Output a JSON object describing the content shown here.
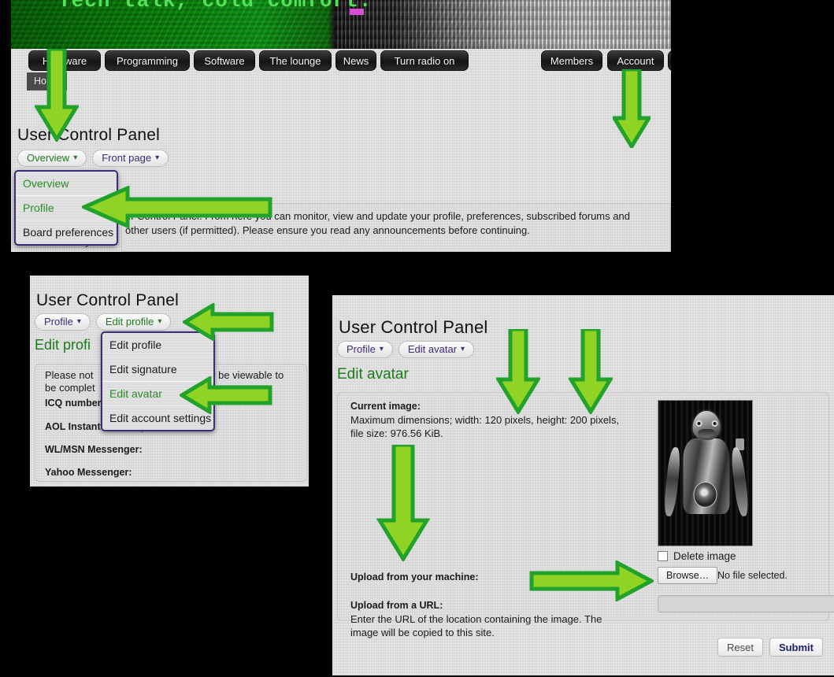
{
  "site": {
    "banner_text": "Tech talk, cold comfort.",
    "nav_items": [
      {
        "label": "Hardware"
      },
      {
        "label": "Programming"
      },
      {
        "label": "Software"
      },
      {
        "label": "The lounge"
      },
      {
        "label": "News"
      },
      {
        "label": "Turn radio on"
      }
    ],
    "nav_right_items": [
      {
        "label": "Members"
      },
      {
        "label": "Account"
      }
    ],
    "breadcrumb": "Home"
  },
  "panel_overview": {
    "title": "User Control Panel",
    "tabs": [
      {
        "label": "Overview",
        "caret": "⌄",
        "active": true
      },
      {
        "label": "Front page",
        "caret": "⌄",
        "active": false
      }
    ],
    "dropdown": [
      {
        "label": "Overview",
        "green": true
      },
      {
        "label": "Profile",
        "green": true
      },
      {
        "label": "Board preferences",
        "green": false
      }
    ],
    "subnav_behind": "Your activity",
    "body_line_1": "er Control Panel. From here you can monitor, view and update your profile, preferences, subscribed forums and",
    "body_line_2": "other users (if permitted). Please ensure you read any announcements before continuing."
  },
  "panel_profile": {
    "title": "User Control Panel",
    "tabs": [
      {
        "label": "Profile",
        "caret": "⌄",
        "active": false
      },
      {
        "label": "Edit profile",
        "caret": "⌄",
        "active": true
      }
    ],
    "section_heading": "Edit profi",
    "dropdown": [
      {
        "label": "Edit profile",
        "green": false
      },
      {
        "label": "Edit signature",
        "green": false
      },
      {
        "label": "Edit avatar",
        "green": true
      },
      {
        "label": "Edit account settings",
        "green": false
      }
    ],
    "note_line_1_left": "Please not",
    "note_line_1_right": "y be viewable to",
    "note_line_2_left": "be complet",
    "fields": [
      {
        "label": "ICQ number"
      },
      {
        "label": "AOL Instant Messenger:"
      },
      {
        "label": "WL/MSN Messenger:"
      },
      {
        "label": "Yahoo Messenger:"
      }
    ]
  },
  "panel_avatar": {
    "title": "User Control Panel",
    "tabs": [
      {
        "label": "Profile",
        "caret": "⌄",
        "active": false
      },
      {
        "label": "Edit avatar",
        "caret": "⌄",
        "active": false
      }
    ],
    "section_heading": "Edit avatar",
    "current_image_label": "Current image:",
    "max_dimensions": "Maximum dimensions; width: 120 pixels, height: 200 pixels,",
    "file_size": "file size: 976.56 KiB.",
    "delete_image_label": "Delete image",
    "upload_machine_label": "Upload from your machine:",
    "browse_label": "Browse…",
    "no_file_selected": "No file selected.",
    "upload_url_label": "Upload from a URL:",
    "upload_url_help_1": "Enter the URL of the location containing the image. The",
    "upload_url_help_2": "image will be copied to this site.",
    "url_value": "",
    "url_placeholder": "",
    "reset_label": "Reset",
    "submit_label": "Submit"
  },
  "annotations": {
    "arrows": [
      {
        "name": "arrow-down-account",
        "direction": "down"
      },
      {
        "name": "arrow-down-user-control-panel",
        "direction": "down"
      },
      {
        "name": "arrow-left-profile-menu-item",
        "direction": "left"
      },
      {
        "name": "arrow-left-edit-profile-tab",
        "direction": "left"
      },
      {
        "name": "arrow-left-edit-avatar-menu-item",
        "direction": "left"
      },
      {
        "name": "arrow-down-max-dimensions",
        "direction": "down"
      },
      {
        "name": "arrow-down-file-size",
        "direction": "down"
      },
      {
        "name": "arrow-down-upload-from-machine",
        "direction": "down"
      },
      {
        "name": "arrow-right-browse-button",
        "direction": "right"
      }
    ]
  },
  "colors": {
    "accent_green": "#8fd424",
    "arrow_outline": "#22a12b",
    "link_green": "#1e7a1e",
    "tab_purple": "#3f2b78",
    "panel_bg": "#d9d9d9",
    "page_bg": "#000000",
    "banner_green": "#13901a",
    "banner_text_green": "#55e05a",
    "banner_cursor": "#d94fd1"
  }
}
